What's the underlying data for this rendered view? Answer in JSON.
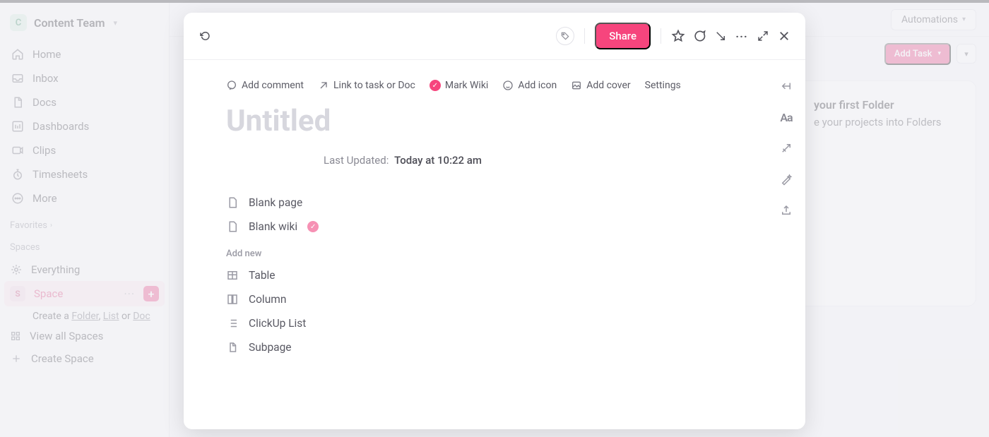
{
  "workspace": {
    "initial": "C",
    "name": "Content Team"
  },
  "nav": {
    "home": "Home",
    "inbox": "Inbox",
    "docs": "Docs",
    "dashboards": "Dashboards",
    "clips": "Clips",
    "timesheets": "Timesheets",
    "more": "More"
  },
  "sections": {
    "favorites": "Favorites",
    "spaces": "Spaces"
  },
  "spaces": {
    "everything": "Everything",
    "space_initial": "S",
    "space_label": "Space",
    "create_prefix": "Create a ",
    "folder_link": "Folder",
    "list_link": "List",
    "or_text": " or ",
    "doc_link": "Doc",
    "view_all": "View all Spaces",
    "create_space": "Create Space"
  },
  "topbar": {
    "automations": "Automations",
    "add_task": "Add Task"
  },
  "folder_card": {
    "title": "your first Folder",
    "subtitle": "e your projects into Folders"
  },
  "modal": {
    "share": "Share",
    "actions": {
      "comment": "Add comment",
      "link_task": "Link to task or Doc",
      "mark_wiki": "Mark Wiki",
      "add_icon": "Add icon",
      "add_cover": "Add cover",
      "settings": "Settings"
    },
    "title_placeholder": "Untitled",
    "last_updated_label": "Last Updated:",
    "last_updated_value": "Today at 10:22 am",
    "templates": {
      "blank_page": "Blank page",
      "blank_wiki": "Blank wiki"
    },
    "add_new_label": "Add new",
    "add_new": {
      "table": "Table",
      "column": "Column",
      "list": "ClickUp List",
      "subpage": "Subpage"
    },
    "aa": "Aa"
  }
}
